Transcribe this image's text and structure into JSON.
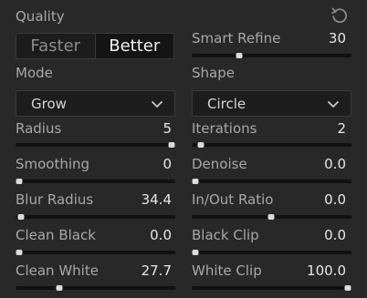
{
  "header": {
    "title": "Quality",
    "reset_icon": "reset-icon"
  },
  "quality": {
    "options": [
      "Faster",
      "Better"
    ],
    "selected": "Better"
  },
  "smart_refine": {
    "label": "Smart Refine",
    "value": "30",
    "level": 0.28
  },
  "mode": {
    "label": "Mode",
    "selected": "Grow"
  },
  "shape": {
    "label": "Shape",
    "selected": "Circle"
  },
  "left_sliders": [
    {
      "label": "Radius",
      "value": "5",
      "level": 1.0
    },
    {
      "label": "Smoothing",
      "value": "0",
      "level": 0.0
    },
    {
      "label": "Blur Radius",
      "value": "34.4",
      "level": 0.03
    },
    {
      "label": "Clean Black",
      "value": "0.0",
      "level": 0.0
    },
    {
      "label": "Clean White",
      "value": "27.7",
      "level": 0.28
    }
  ],
  "right_sliders": [
    {
      "label": "Iterations",
      "value": "2",
      "level": 0.03
    },
    {
      "label": "Denoise",
      "value": "0.0",
      "level": 0.0
    },
    {
      "label": "In/Out Ratio",
      "value": "0.0",
      "level": 0.5
    },
    {
      "label": "Black Clip",
      "value": "0.0",
      "level": 0.0
    },
    {
      "label": "White Clip",
      "value": "100.0",
      "level": 1.0
    }
  ]
}
